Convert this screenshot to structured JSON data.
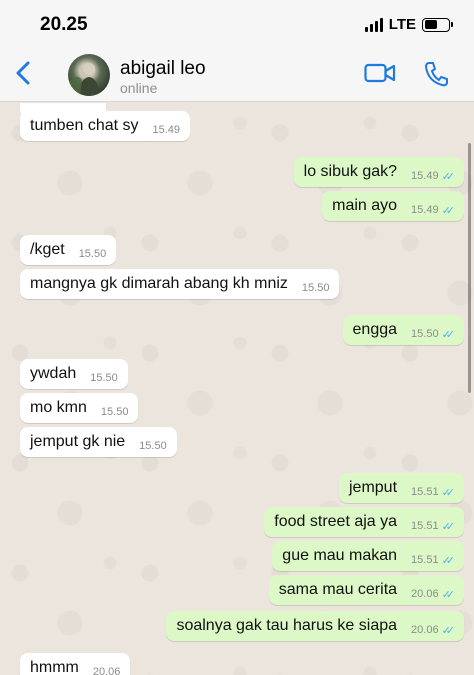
{
  "status_bar": {
    "time": "20.25",
    "network": "LTE",
    "battery_level": 0.55
  },
  "header": {
    "contact_name": "abigail leo",
    "contact_status": "online",
    "icons": {
      "back": "chevron-left-icon",
      "video": "video-camera-icon",
      "call": "phone-icon"
    },
    "accent_color": "#1f7ae0"
  },
  "messages": [
    {
      "direction": "in",
      "text": "tumben chat sy",
      "time": "15.49"
    },
    {
      "direction": "out",
      "text": "lo sibuk gak?",
      "time": "15.49",
      "ticks": "✓✓"
    },
    {
      "direction": "out",
      "text": "main ayo",
      "time": "15.49",
      "ticks": "✓✓"
    },
    {
      "direction": "in",
      "text": "/kget",
      "time": "15.50"
    },
    {
      "direction": "in",
      "text": "mangnya gk dimarah abang kh mniz",
      "time": "15.50"
    },
    {
      "direction": "out",
      "text": "engga",
      "time": "15.50",
      "ticks": "✓✓"
    },
    {
      "direction": "in",
      "text": "ywdah",
      "time": "15.50"
    },
    {
      "direction": "in",
      "text": "mo kmn",
      "time": "15.50"
    },
    {
      "direction": "in",
      "text": "jemput gk nie",
      "time": "15.50"
    },
    {
      "direction": "out",
      "text": "jemput",
      "time": "15.51",
      "ticks": "✓✓"
    },
    {
      "direction": "out",
      "text": "food street aja ya",
      "time": "15.51",
      "ticks": "✓✓"
    },
    {
      "direction": "out",
      "text": "gue mau makan",
      "time": "15.51",
      "ticks": "✓✓"
    },
    {
      "direction": "out",
      "text": "sama mau cerita",
      "time": "20.06",
      "ticks": "✓✓"
    },
    {
      "direction": "out",
      "text": "soalnya gak tau harus ke siapa",
      "time": "20.06",
      "ticks": "✓✓"
    },
    {
      "direction": "in",
      "text": "hmmm",
      "time": "20.06"
    }
  ],
  "colors": {
    "incoming_bubble": "#ffffff",
    "outgoing_bubble": "#dcf8c6",
    "read_ticks": "#4fb6ec",
    "chat_background": "#ece5dd"
  }
}
